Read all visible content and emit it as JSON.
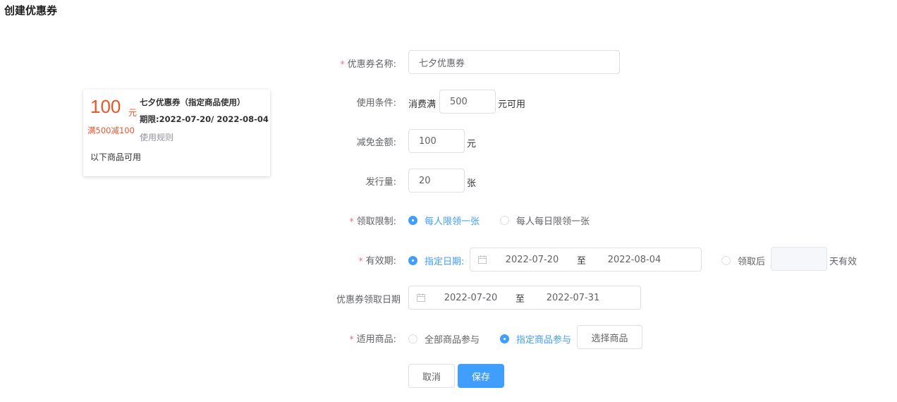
{
  "page": {
    "title": "创建优惠券"
  },
  "preview": {
    "amount": "100",
    "unit": "元",
    "rule": "满500减100",
    "name": "七夕优惠券（指定商品使用）",
    "period": "期限:2022-07-20/ 2022-08-04",
    "usage_label": "使用规则",
    "scope": "以下商品可用"
  },
  "form": {
    "name": {
      "label": "优惠券名称:",
      "value": "七夕优惠券"
    },
    "condition": {
      "label": "使用条件:",
      "prefix": "消费满",
      "value": "500",
      "suffix": "元可用"
    },
    "discount": {
      "label": "减免金额:",
      "value": "100",
      "suffix": "元"
    },
    "quantity": {
      "label": "发行量:",
      "value": "20",
      "suffix": "张"
    },
    "limit": {
      "label": "领取限制:",
      "options": [
        "每人限领一张",
        "每人每日限领一张"
      ],
      "selected": 0
    },
    "validity": {
      "label": "有效期:",
      "option_fixed": "指定日期:",
      "start": "2022-07-20",
      "separator": "至",
      "end": "2022-08-04",
      "option_relative_prefix": "领取后",
      "relative_days": "",
      "option_relative_suffix": "天有效"
    },
    "claim_period": {
      "label": "优惠券领取日期",
      "start": "2022-07-20",
      "separator": "至",
      "end": "2022-07-31"
    },
    "scope": {
      "label": "适用商品:",
      "options": [
        "全部商品参与",
        "指定商品参与"
      ],
      "selected": 1,
      "select_button": "选择商品"
    }
  },
  "actions": {
    "cancel": "取消",
    "save": "保存"
  },
  "colors": {
    "accent": "#409eff",
    "price": "#e8562a",
    "required": "#f56c6c"
  },
  "icons": {
    "calendar": "calendar-icon"
  }
}
